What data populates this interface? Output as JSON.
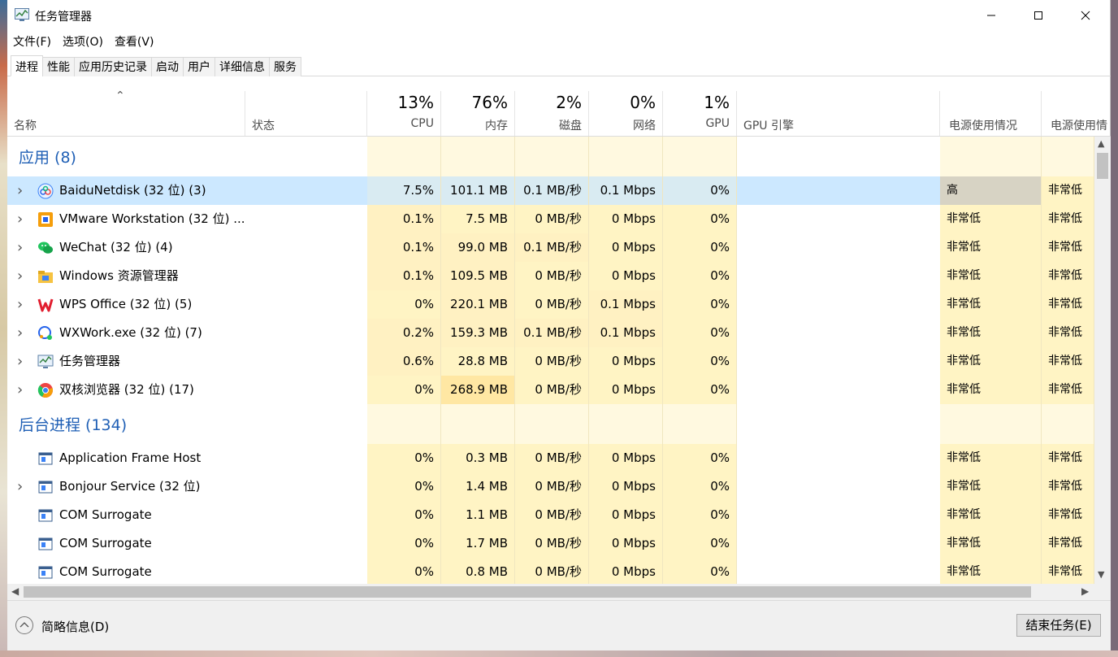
{
  "window": {
    "title": "任务管理器"
  },
  "menu": [
    {
      "label": "文件(F)"
    },
    {
      "label": "选项(O)"
    },
    {
      "label": "查看(V)"
    }
  ],
  "tabs": [
    {
      "label": "进程",
      "active": true
    },
    {
      "label": "性能"
    },
    {
      "label": "应用历史记录"
    },
    {
      "label": "启动"
    },
    {
      "label": "用户"
    },
    {
      "label": "详细信息"
    },
    {
      "label": "服务"
    }
  ],
  "columns": {
    "name": {
      "label": "名称"
    },
    "status": {
      "label": "状态"
    },
    "cpu": {
      "pct": "13%",
      "label": "CPU"
    },
    "memory": {
      "pct": "76%",
      "label": "内存"
    },
    "disk": {
      "pct": "2%",
      "label": "磁盘"
    },
    "network": {
      "pct": "0%",
      "label": "网络"
    },
    "gpu": {
      "pct": "1%",
      "label": "GPU"
    },
    "gpu_engine": {
      "label": "GPU 引擎"
    },
    "power": {
      "label": "电源使用情况"
    },
    "power_trend": {
      "label": "电源使用情"
    }
  },
  "groups": [
    {
      "title": "应用 (8)",
      "rows": [
        {
          "name": "BaiduNetdisk (32 位) (3)",
          "icon": "baidunetdisk-icon",
          "expand": true,
          "selected": true,
          "cpu": "7.5%",
          "mem": "101.1 MB",
          "disk": "0.1 MB/秒",
          "net": "0.1 Mbps",
          "gpu": "0%",
          "power": "高",
          "trend": "非常低"
        },
        {
          "name": "VMware Workstation (32 位) ...",
          "icon": "vmware-icon",
          "expand": true,
          "cpu": "0.1%",
          "mem": "7.5 MB",
          "disk": "0 MB/秒",
          "net": "0 Mbps",
          "gpu": "0%",
          "power": "非常低",
          "trend": "非常低"
        },
        {
          "name": "WeChat (32 位) (4)",
          "icon": "wechat-icon",
          "expand": true,
          "cpu": "0.1%",
          "mem": "99.0 MB",
          "disk": "0.1 MB/秒",
          "net": "0 Mbps",
          "gpu": "0%",
          "power": "非常低",
          "trend": "非常低"
        },
        {
          "name": "Windows 资源管理器",
          "icon": "explorer-folder-icon",
          "expand": true,
          "cpu": "0.1%",
          "mem": "109.5 MB",
          "disk": "0 MB/秒",
          "net": "0 Mbps",
          "gpu": "0%",
          "power": "非常低",
          "trend": "非常低"
        },
        {
          "name": "WPS Office (32 位) (5)",
          "icon": "wps-icon",
          "expand": true,
          "cpu": "0%",
          "mem": "220.1 MB",
          "disk": "0 MB/秒",
          "net": "0.1 Mbps",
          "gpu": "0%",
          "power": "非常低",
          "trend": "非常低"
        },
        {
          "name": "WXWork.exe (32 位) (7)",
          "icon": "wxwork-icon",
          "expand": true,
          "cpu": "0.2%",
          "mem": "159.3 MB",
          "disk": "0.1 MB/秒",
          "net": "0.1 Mbps",
          "gpu": "0%",
          "power": "非常低",
          "trend": "非常低"
        },
        {
          "name": "任务管理器",
          "icon": "task-manager-icon",
          "expand": true,
          "cpu": "0.6%",
          "mem": "28.8 MB",
          "disk": "0 MB/秒",
          "net": "0 Mbps",
          "gpu": "0%",
          "power": "非常低",
          "trend": "非常低"
        },
        {
          "name": "双核浏览器 (32 位) (17)",
          "icon": "browser-icon",
          "expand": true,
          "cpu": "0%",
          "mem": "268.9 MB",
          "disk": "0 MB/秒",
          "net": "0 Mbps",
          "gpu": "0%",
          "power": "非常低",
          "trend": "非常低"
        }
      ]
    },
    {
      "title": "后台进程 (134)",
      "rows": [
        {
          "name": "Application Frame Host",
          "icon": "window-process-icon",
          "expand": false,
          "cpu": "0%",
          "mem": "0.3 MB",
          "disk": "0 MB/秒",
          "net": "0 Mbps",
          "gpu": "0%",
          "power": "非常低",
          "trend": "非常低"
        },
        {
          "name": "Bonjour Service (32 位)",
          "icon": "window-process-icon",
          "expand": true,
          "cpu": "0%",
          "mem": "1.4 MB",
          "disk": "0 MB/秒",
          "net": "0 Mbps",
          "gpu": "0%",
          "power": "非常低",
          "trend": "非常低"
        },
        {
          "name": "COM Surrogate",
          "icon": "window-process-icon",
          "expand": false,
          "cpu": "0%",
          "mem": "1.1 MB",
          "disk": "0 MB/秒",
          "net": "0 Mbps",
          "gpu": "0%",
          "power": "非常低",
          "trend": "非常低"
        },
        {
          "name": "COM Surrogate",
          "icon": "window-process-icon",
          "expand": false,
          "cpu": "0%",
          "mem": "1.7 MB",
          "disk": "0 MB/秒",
          "net": "0 Mbps",
          "gpu": "0%",
          "power": "非常低",
          "trend": "非常低"
        },
        {
          "name": "COM Surrogate",
          "icon": "window-process-icon",
          "expand": false,
          "cpu": "0%",
          "mem": "0.8 MB",
          "disk": "0 MB/秒",
          "net": "0 Mbps",
          "gpu": "0%",
          "power": "非常低",
          "trend": "非常低"
        }
      ]
    }
  ],
  "footer": {
    "fewer_details": "简略信息(D)",
    "end_task": "结束任务(E)"
  }
}
